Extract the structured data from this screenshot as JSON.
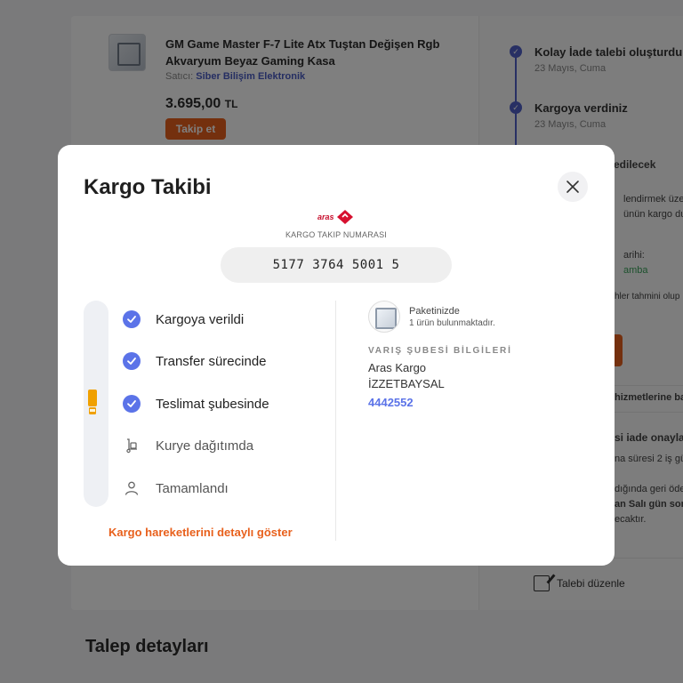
{
  "background": {
    "product": {
      "title": "GM Game Master F-7 Lite Atx Tuştan Değişen Rgb Akvaryum Beyaz Gaming Kasa",
      "seller_label": "Satıcı:",
      "seller_name": "Siber Bilişim Elektronik",
      "price": "3.695,00",
      "currency": "TL",
      "follow_label": "Takip et"
    },
    "timeline": [
      {
        "title": "Kolay İade talebi oluşturdunu",
        "date": "23 Mayıs, Cuma"
      },
      {
        "title": "Kargoya verdiniz",
        "date": "23 Mayıs, Cuma"
      }
    ],
    "fragments": {
      "edilecek": "edilecek",
      "frag_1": "lendirmek üzere",
      "frag_2": "ünün kargo duru",
      "frag_3": "arihi:",
      "frag_4": "amba",
      "frag_5": "hler tahmini olup",
      "frag_6": "hizmetlerine ba",
      "frag_7": "si iade onayla",
      "frag_8": "na süresi 2 iş gü",
      "frag_9": "dığında geri öde",
      "frag_10": "an Salı gün sonu",
      "frag_11": "ecaktır."
    },
    "edit_request": "Talebi düzenle",
    "request_details": "Talep detayları"
  },
  "modal": {
    "title": "Kargo Takibi",
    "carrier_logo_text": "aras",
    "tracking_caption": "KARGO TAKIP NUMARASI",
    "tracking_number": "5177 3764 5001 5",
    "steps": [
      {
        "label": "Kargoya verildi",
        "status": "done",
        "icon": "check-icon"
      },
      {
        "label": "Transfer sürecinde",
        "status": "done",
        "icon": "check-icon"
      },
      {
        "label": "Teslimat şubesinde",
        "status": "done",
        "icon": "check-icon"
      },
      {
        "label": "Kurye dağıtımda",
        "status": "pending",
        "icon": "courier-icon"
      },
      {
        "label": "Tamamlandı",
        "status": "pending",
        "icon": "person-icon"
      }
    ],
    "details_link": "Kargo hareketlerini detaylı göster",
    "package": {
      "title": "Paketinizde",
      "subtitle": "1 ürün bulunmaktadır."
    },
    "branch": {
      "heading": "VARIŞ ŞUBESİ BİLGİLERİ",
      "company": "Aras Kargo",
      "name": "İZZETBAYSAL",
      "phone": "4442552"
    }
  },
  "colors": {
    "accent_blue": "#5b73e8",
    "accent_orange": "#e8601c",
    "overlay": "rgba(0,0,0,0.5)"
  }
}
